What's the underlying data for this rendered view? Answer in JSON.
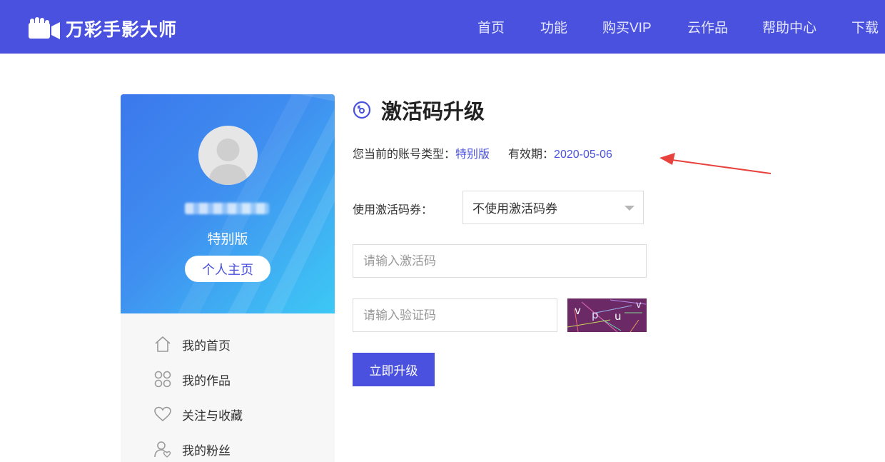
{
  "header": {
    "brand": "万彩手影大师",
    "nav": [
      {
        "label": "首页"
      },
      {
        "label": "功能"
      },
      {
        "label": "购买VIP"
      },
      {
        "label": "云作品"
      },
      {
        "label": "帮助中心"
      },
      {
        "label": "下载"
      }
    ]
  },
  "sidebar": {
    "account_type": "特别版",
    "home_button": "个人主页",
    "menu": [
      {
        "label": "我的首页",
        "icon": "home-icon"
      },
      {
        "label": "我的作品",
        "icon": "grid-icon"
      },
      {
        "label": "关注与收藏",
        "icon": "heart-icon"
      },
      {
        "label": "我的粉丝",
        "icon": "fans-icon"
      }
    ]
  },
  "main": {
    "title": "激活码升级",
    "account_label": "您当前的账号类型：",
    "account_value": "特别版",
    "expiry_label": "有效期：",
    "expiry_value": "2020-05-06",
    "coupon_label": "使用激活码券：",
    "coupon_selected": "不使用激活码券",
    "code_placeholder": "请输入激活码",
    "verify_placeholder": "请输入验证码",
    "captcha_text": "v p u v",
    "submit_label": "立即升级"
  },
  "colors": {
    "brand": "#4a51de",
    "annotation_arrow": "#e8423f"
  }
}
